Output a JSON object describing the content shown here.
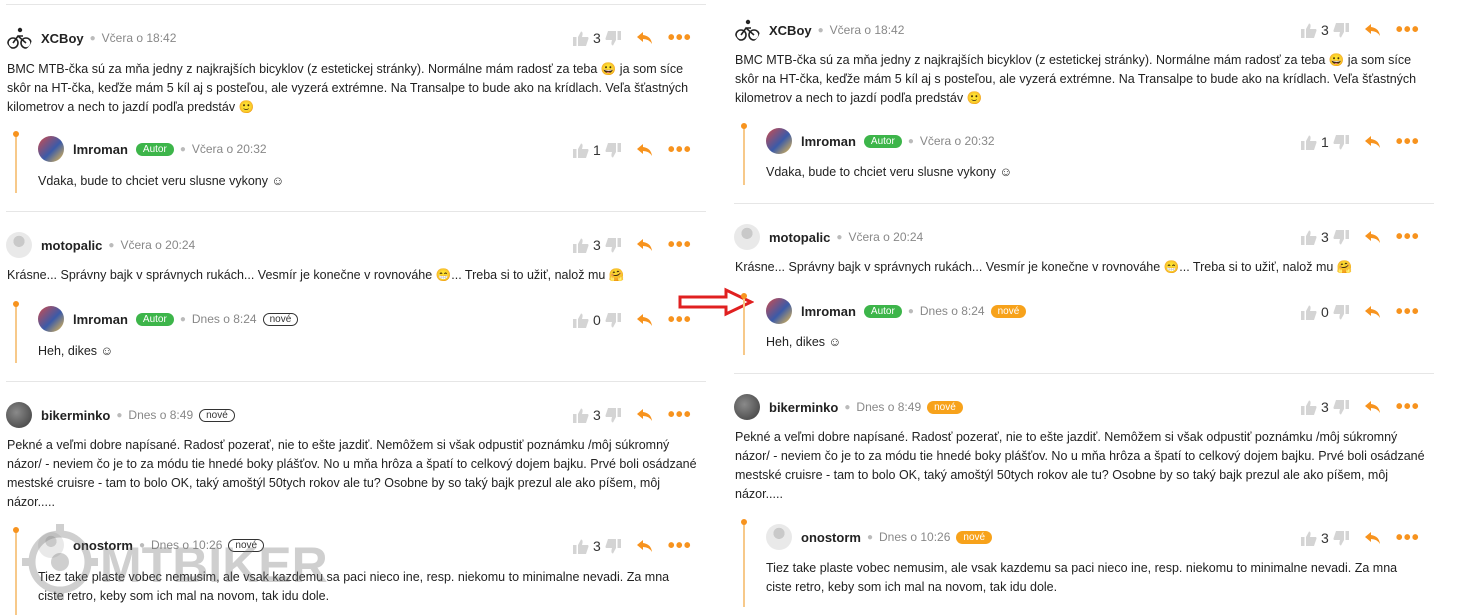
{
  "left": {
    "c1": {
      "user": "XCBoy",
      "time": "Včera o 18:42",
      "votes": "3",
      "text": "BMC MTB-čka sú za mňa jedny z najkrajších bicyklov (z estetickej stránky). Normálne mám radosť za teba 😀 ja som síce skôr na HT-čka, keďže mám 5 kíl aj s posteľou, ale vyzerá extrémne. Na Transalpe to bude ako na krídlach. Veľa šťastných kilometrov a nech to jazdí podľa predstáv 🙂"
    },
    "r1": {
      "user": "lmroman",
      "badge": "Autor",
      "time": "Včera o 20:32",
      "votes": "1",
      "text": "Vdaka, bude to chciet veru slusne vykony ☺"
    },
    "c2": {
      "user": "motopalic",
      "time": "Včera o 20:24",
      "votes": "3",
      "text": "Krásne... Správny bajk v správnych rukách... Vesmír je konečne v rovnováhe 😁... Treba si to užiť, nalož mu 🤗"
    },
    "r2": {
      "user": "lmroman",
      "badge": "Autor",
      "time": "Dnes o 8:24",
      "new": "nové",
      "votes": "0",
      "text": "Heh, dikes ☺"
    },
    "c3": {
      "user": "bikerminko",
      "time": "Dnes o 8:49",
      "new": "nové",
      "votes": "3",
      "text": "Pekné a veľmi dobre napísané. Radosť pozerať, nie to ešte jazdiť. Nemôžem si však odpustiť poznámku /môj súkromný názor/ - neviem čo je to za módu tie hnedé boky plášťov. No u mňa hrôza a špatí to celkový dojem bajku. Prvé boli osádzané mestské cruisre - tam to bolo OK, taký amoštýl 50tych rokov ale tu? Osobne by so taký bajk prezul ale ako píšem, môj názor....."
    },
    "r3": {
      "user": "onostorm",
      "time": "Dnes o 10:26",
      "new": "nové",
      "votes": "3",
      "text": "Tiez take plaste vobec nemusim, ale vsak kazdemu sa paci nieco ine, resp. niekomu to minimalne nevadi. Za mna ciste retro, keby som ich mal na novom, tak idu dole."
    }
  },
  "right": {
    "c1": {
      "user": "XCBoy",
      "time": "Včera o 18:42",
      "votes": "3",
      "text": "BMC MTB-čka sú za mňa jedny z najkrajších bicyklov (z estetickej stránky). Normálne mám radosť za teba 😀 ja som síce skôr na HT-čka, keďže mám 5 kíl aj s posteľou, ale vyzerá extrémne. Na Transalpe to bude ako na krídlach. Veľa šťastných kilometrov a nech to jazdí podľa predstáv 🙂"
    },
    "r1": {
      "user": "lmroman",
      "badge": "Autor",
      "time": "Včera o 20:32",
      "votes": "1",
      "text": "Vdaka, bude to chciet veru slusne vykony ☺"
    },
    "c2": {
      "user": "motopalic",
      "time": "Včera o 20:24",
      "votes": "3",
      "text": "Krásne... Správny bajk v správnych rukách... Vesmír je konečne v rovnováhe 😁... Treba si to užiť, nalož mu 🤗"
    },
    "r2": {
      "user": "lmroman",
      "badge": "Autor",
      "time": "Dnes o 8:24",
      "new": "nové",
      "votes": "0",
      "text": "Heh, dikes ☺"
    },
    "c3": {
      "user": "bikerminko",
      "time": "Dnes o 8:49",
      "new": "nové",
      "votes": "3",
      "text": "Pekné a veľmi dobre napísané. Radosť pozerať, nie to ešte jazdiť. Nemôžem si však odpustiť poznámku /môj súkromný názor/ - neviem čo je to za módu tie hnedé boky plášťov. No u mňa hrôza a špatí to celkový dojem bajku. Prvé boli osádzané mestské cruisre - tam to bolo OK, taký amoštýl 50tych rokov ale tu? Osobne by so taký bajk prezul ale ako píšem, môj názor....."
    },
    "r3": {
      "user": "onostorm",
      "time": "Dnes o 10:26",
      "new": "nové",
      "votes": "3",
      "text": "Tiez take plaste vobec nemusim, ale vsak kazdemu sa paci nieco ine, resp. niekomu to minimalne nevadi. Za mna ciste retro, keby som ich mal na novom, tak idu dole."
    }
  },
  "watermark": "MTBIKER",
  "colors": {
    "accent": "#f7931e",
    "author_badge": "#3db54a",
    "new_badge": "#f7a21b",
    "thread_line": "#f7c98a",
    "arrow": "#e02020"
  }
}
